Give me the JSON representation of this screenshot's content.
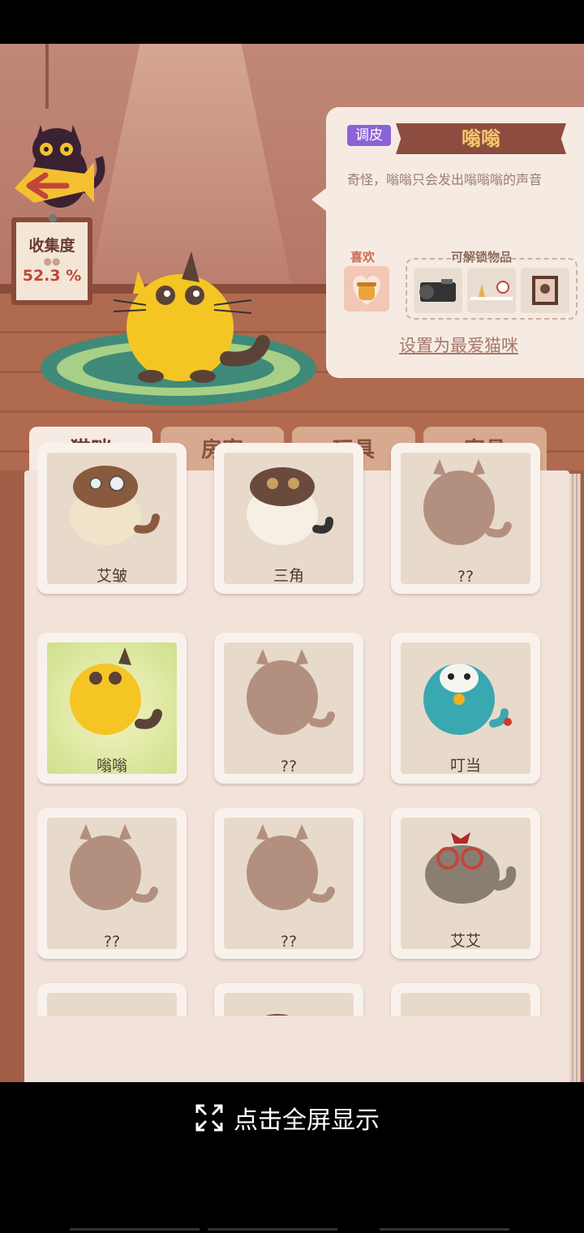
{
  "collection": {
    "label": "收集度",
    "value": "52.3 %"
  },
  "selected_cat": {
    "tag": "调皮",
    "name": "嗡嗡",
    "description": "奇怪，嗡嗡只会发出嗡嗡嗡的声音",
    "likes_label": "喜欢",
    "unlock_label": "可解锁物品",
    "set_favorite": "设置为最爱猫咪"
  },
  "tabs": [
    {
      "label": "猫咪",
      "active": true
    },
    {
      "label": "房客",
      "active": false
    },
    {
      "label": "玩具",
      "active": false
    },
    {
      "label": "家具",
      "active": false
    }
  ],
  "cats": [
    {
      "name": "艾皱",
      "kind": "monocle"
    },
    {
      "name": "三角",
      "kind": "tricolor"
    },
    {
      "name": "??",
      "kind": "locked"
    },
    {
      "name": "嗡嗡",
      "kind": "yellow",
      "selected": true
    },
    {
      "name": "??",
      "kind": "locked"
    },
    {
      "name": "叮当",
      "kind": "blue"
    },
    {
      "name": "??",
      "kind": "locked"
    },
    {
      "name": "??",
      "kind": "locked"
    },
    {
      "name": "艾艾",
      "kind": "grey"
    },
    {
      "name": "",
      "kind": "white"
    },
    {
      "name": "",
      "kind": "brown"
    },
    {
      "name": "",
      "kind": "siamese"
    }
  ],
  "fullscreen": {
    "label": "点击全屏显示",
    "icon": "expand-icon"
  },
  "colors": {
    "yellow_cat": "#f5c524",
    "locked_cat": "#b38f7f",
    "tag_purple": "#8b63d6",
    "banner": "#8c4d40"
  }
}
